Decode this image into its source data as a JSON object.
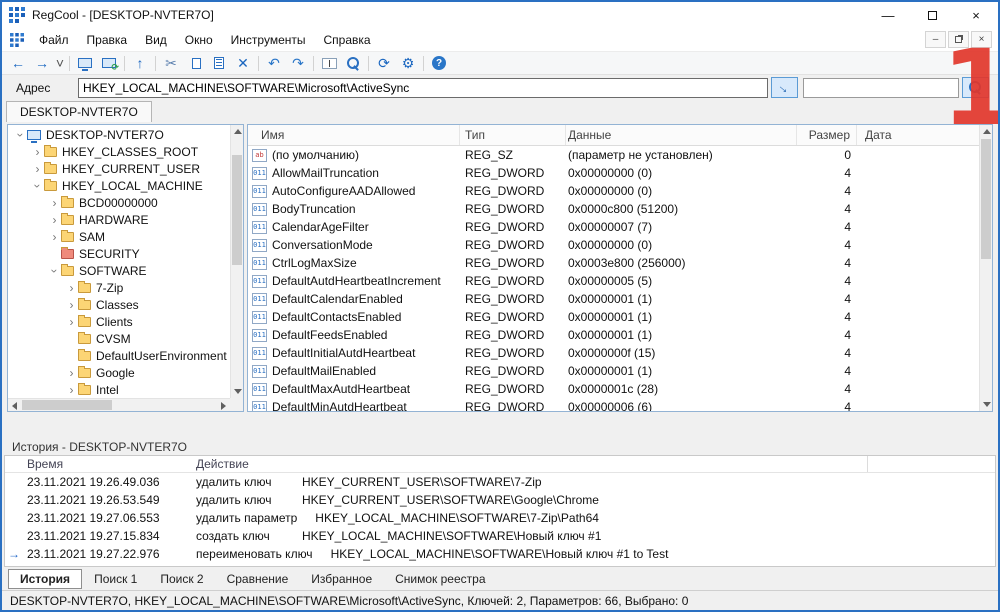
{
  "window": {
    "title": "RegCool - [DESKTOP-NVTER7O]",
    "controls": {
      "minimize": "—",
      "close": "×"
    }
  },
  "menubar": {
    "items": [
      {
        "key": "file",
        "label": "Файл"
      },
      {
        "key": "edit",
        "label": "Правка"
      },
      {
        "key": "view",
        "label": "Вид"
      },
      {
        "key": "window",
        "label": "Окно"
      },
      {
        "key": "tools",
        "label": "Инструменты"
      },
      {
        "key": "help",
        "label": "Справка"
      }
    ],
    "mdi_minimize": "–",
    "mdi_close": "×"
  },
  "toolbar": {
    "buttons": [
      {
        "name": "back",
        "kind": "glyph",
        "glyph": "←",
        "color": "#1a66c0"
      },
      {
        "name": "forward",
        "kind": "glyph",
        "glyph": "→",
        "color": "#1a66c0"
      },
      {
        "name": "history-dropdown",
        "kind": "glyph",
        "glyph": "˅",
        "color": "#555",
        "small": true
      },
      {
        "kind": "sep"
      },
      {
        "name": "connect",
        "kind": "monitor"
      },
      {
        "name": "reconnect",
        "kind": "monitor-sync"
      },
      {
        "kind": "sep"
      },
      {
        "name": "parent-key",
        "kind": "glyph",
        "glyph": "↑",
        "color": "#1a66c0"
      },
      {
        "kind": "sep"
      },
      {
        "name": "cut",
        "kind": "glyph",
        "glyph": "✂",
        "color": "#5a7fae"
      },
      {
        "name": "copy",
        "kind": "copy"
      },
      {
        "name": "export",
        "kind": "page"
      },
      {
        "name": "delete",
        "kind": "glyph",
        "glyph": "✕",
        "color": "#1a66c0"
      },
      {
        "kind": "sep"
      },
      {
        "name": "undo",
        "kind": "glyph",
        "glyph": "↶",
        "color": "#2a76c8"
      },
      {
        "name": "redo",
        "kind": "glyph",
        "glyph": "↷",
        "color": "#2a76c8"
      },
      {
        "kind": "sep"
      },
      {
        "name": "rename",
        "kind": "textbox"
      },
      {
        "name": "find",
        "kind": "search"
      },
      {
        "kind": "sep"
      },
      {
        "name": "refresh",
        "kind": "glyph",
        "glyph": "⟳",
        "color": "#1a66c0"
      },
      {
        "name": "settings",
        "kind": "glyph",
        "glyph": "⚙",
        "color": "#1a66c0"
      },
      {
        "kind": "sep"
      },
      {
        "name": "help",
        "kind": "help"
      }
    ]
  },
  "addressbar": {
    "label": "Адрес",
    "value": "HKEY_LOCAL_MACHINE\\SOFTWARE\\Microsoft\\ActiveSync",
    "filter_value": ""
  },
  "view_tabs": [
    {
      "label": "DESKTOP-NVTER7O",
      "active": true
    }
  ],
  "tree": {
    "items": [
      {
        "label": "DESKTOP-NVTER7O",
        "level": 0,
        "icon": "computer",
        "expander": "down"
      },
      {
        "label": "HKEY_CLASSES_ROOT",
        "level": 1,
        "icon": "folder-yellow",
        "expander": "right"
      },
      {
        "label": "HKEY_CURRENT_USER",
        "level": 1,
        "icon": "folder-yellow",
        "expander": "right"
      },
      {
        "label": "HKEY_LOCAL_MACHINE",
        "level": 1,
        "icon": "folder-yellow",
        "expander": "down"
      },
      {
        "label": "BCD00000000",
        "level": 2,
        "icon": "folder-yellow",
        "expander": "right"
      },
      {
        "label": "HARDWARE",
        "level": 2,
        "icon": "folder-yellow",
        "expander": "right"
      },
      {
        "label": "SAM",
        "level": 2,
        "icon": "folder-yellow",
        "expander": "right"
      },
      {
        "label": "SECURITY",
        "level": 2,
        "icon": "folder-red",
        "expander": "none"
      },
      {
        "label": "SOFTWARE",
        "level": 2,
        "icon": "folder-yellow",
        "expander": "down"
      },
      {
        "label": "7-Zip",
        "level": 3,
        "icon": "folder-yellow",
        "expander": "right"
      },
      {
        "label": "Classes",
        "level": 3,
        "icon": "folder-yellow",
        "expander": "right"
      },
      {
        "label": "Clients",
        "level": 3,
        "icon": "folder-yellow",
        "expander": "right"
      },
      {
        "label": "CVSM",
        "level": 3,
        "icon": "folder-yellow",
        "expander": "none"
      },
      {
        "label": "DefaultUserEnvironment",
        "level": 3,
        "icon": "folder-yellow",
        "expander": "none"
      },
      {
        "label": "Google",
        "level": 3,
        "icon": "folder-yellow",
        "expander": "right"
      },
      {
        "label": "Intel",
        "level": 3,
        "icon": "folder-yellow",
        "expander": "right"
      }
    ]
  },
  "values_table": {
    "columns": [
      {
        "key": "name",
        "label": "Имя"
      },
      {
        "key": "type",
        "label": "Тип"
      },
      {
        "key": "data",
        "label": "Данные"
      },
      {
        "key": "size",
        "label": "Размер"
      },
      {
        "key": "date",
        "label": "Дата"
      }
    ],
    "rows": [
      {
        "icon": "sz",
        "name": "(по умолчанию)",
        "type": "REG_SZ",
        "data": "(параметр не установлен)",
        "size": "0"
      },
      {
        "icon": "dword",
        "name": "AllowMailTruncation",
        "type": "REG_DWORD",
        "data": "0x00000000 (0)",
        "size": "4"
      },
      {
        "icon": "dword",
        "name": "AutoConfigureAADAllowed",
        "type": "REG_DWORD",
        "data": "0x00000000 (0)",
        "size": "4"
      },
      {
        "icon": "dword",
        "name": "BodyTruncation",
        "type": "REG_DWORD",
        "data": "0x0000c800 (51200)",
        "size": "4"
      },
      {
        "icon": "dword",
        "name": "CalendarAgeFilter",
        "type": "REG_DWORD",
        "data": "0x00000007 (7)",
        "size": "4"
      },
      {
        "icon": "dword",
        "name": "ConversationMode",
        "type": "REG_DWORD",
        "data": "0x00000000 (0)",
        "size": "4"
      },
      {
        "icon": "dword",
        "name": "CtrlLogMaxSize",
        "type": "REG_DWORD",
        "data": "0x0003e800 (256000)",
        "size": "4"
      },
      {
        "icon": "dword",
        "name": "DefaultAutdHeartbeatIncrement",
        "type": "REG_DWORD",
        "data": "0x00000005 (5)",
        "size": "4"
      },
      {
        "icon": "dword",
        "name": "DefaultCalendarEnabled",
        "type": "REG_DWORD",
        "data": "0x00000001 (1)",
        "size": "4"
      },
      {
        "icon": "dword",
        "name": "DefaultContactsEnabled",
        "type": "REG_DWORD",
        "data": "0x00000001 (1)",
        "size": "4"
      },
      {
        "icon": "dword",
        "name": "DefaultFeedsEnabled",
        "type": "REG_DWORD",
        "data": "0x00000001 (1)",
        "size": "4"
      },
      {
        "icon": "dword",
        "name": "DefaultInitialAutdHeartbeat",
        "type": "REG_DWORD",
        "data": "0x0000000f (15)",
        "size": "4"
      },
      {
        "icon": "dword",
        "name": "DefaultMailEnabled",
        "type": "REG_DWORD",
        "data": "0x00000001 (1)",
        "size": "4"
      },
      {
        "icon": "dword",
        "name": "DefaultMaxAutdHeartbeat",
        "type": "REG_DWORD",
        "data": "0x0000001c (28)",
        "size": "4"
      },
      {
        "icon": "dword",
        "name": "DefaultMinAutdHeartbeat",
        "type": "REG_DWORD",
        "data": "0x00000006 (6)",
        "size": "4"
      }
    ]
  },
  "history": {
    "caption": "История - DESKTOP-NVTER7O",
    "columns": [
      {
        "key": "time",
        "label": "Время"
      },
      {
        "key": "action",
        "label": "Действие"
      }
    ],
    "rows": [
      {
        "time": "23.11.2021 19.26.49.036",
        "action": "удалить ключ",
        "path": "HKEY_CURRENT_USER\\SOFTWARE\\7-Zip",
        "current": false
      },
      {
        "time": "23.11.2021 19.26.53.549",
        "action": "удалить ключ",
        "path": "HKEY_CURRENT_USER\\SOFTWARE\\Google\\Chrome",
        "current": false
      },
      {
        "time": "23.11.2021 19.27.06.553",
        "action": "удалить параметр",
        "path": "HKEY_LOCAL_MACHINE\\SOFTWARE\\7-Zip\\Path64",
        "current": false
      },
      {
        "time": "23.11.2021 19.27.15.834",
        "action": "создать ключ",
        "path": "HKEY_LOCAL_MACHINE\\SOFTWARE\\Новый ключ #1",
        "current": false
      },
      {
        "time": "23.11.2021 19.27.22.976",
        "action": "переименовать ключ",
        "path": "HKEY_LOCAL_MACHINE\\SOFTWARE\\Новый ключ #1 to Test",
        "current": true
      }
    ],
    "current_marker": "→"
  },
  "bottom_tabs": [
    {
      "key": "history",
      "label": "История",
      "active": true
    },
    {
      "key": "search1",
      "label": "Поиск 1",
      "active": false
    },
    {
      "key": "search2",
      "label": "Поиск 2",
      "active": false
    },
    {
      "key": "compare",
      "label": "Сравнение",
      "active": false
    },
    {
      "key": "favorites",
      "label": "Избранное",
      "active": false
    },
    {
      "key": "snapshot",
      "label": "Снимок реестра",
      "active": false
    }
  ],
  "statusbar": {
    "text": "DESKTOP-NVTER7O, HKEY_LOCAL_MACHINE\\SOFTWARE\\Microsoft\\ActiveSync, Ключей: 2, Параметров: 66, Выбрано: 0"
  },
  "watermark": {
    "text": "1",
    "color": "#e2372c"
  }
}
